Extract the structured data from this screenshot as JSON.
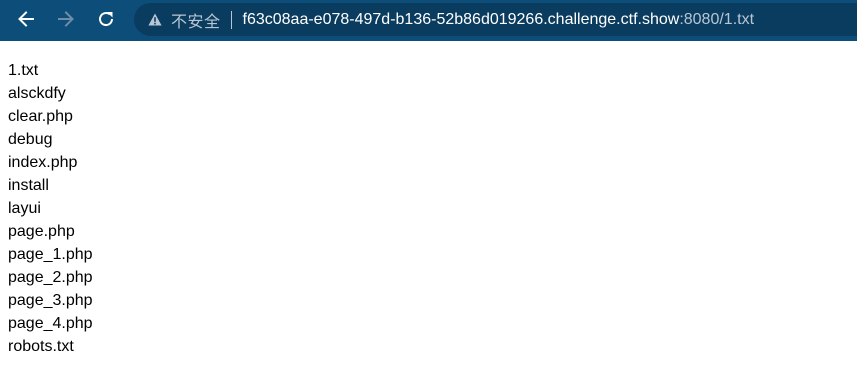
{
  "browser": {
    "toolbar_color": "#0d4d7a",
    "omnibox_color": "#0a3c5f",
    "back_icon": "arrow-left-icon",
    "forward_icon": "arrow-right-icon",
    "reload_icon": "reload-icon",
    "security_icon": "warning-triangle-icon",
    "security_label": "不安全",
    "url_host": "f63c08aa-e078-497d-b136-52b86d019266.challenge.ctf.show",
    "url_rest": ":8080/1.txt"
  },
  "page": {
    "lines": [
      "1.txt",
      "alsckdfy",
      "clear.php",
      "debug",
      "index.php",
      "install",
      "layui",
      "page.php",
      "page_1.php",
      "page_2.php",
      "page_3.php",
      "page_4.php",
      "robots.txt"
    ]
  }
}
